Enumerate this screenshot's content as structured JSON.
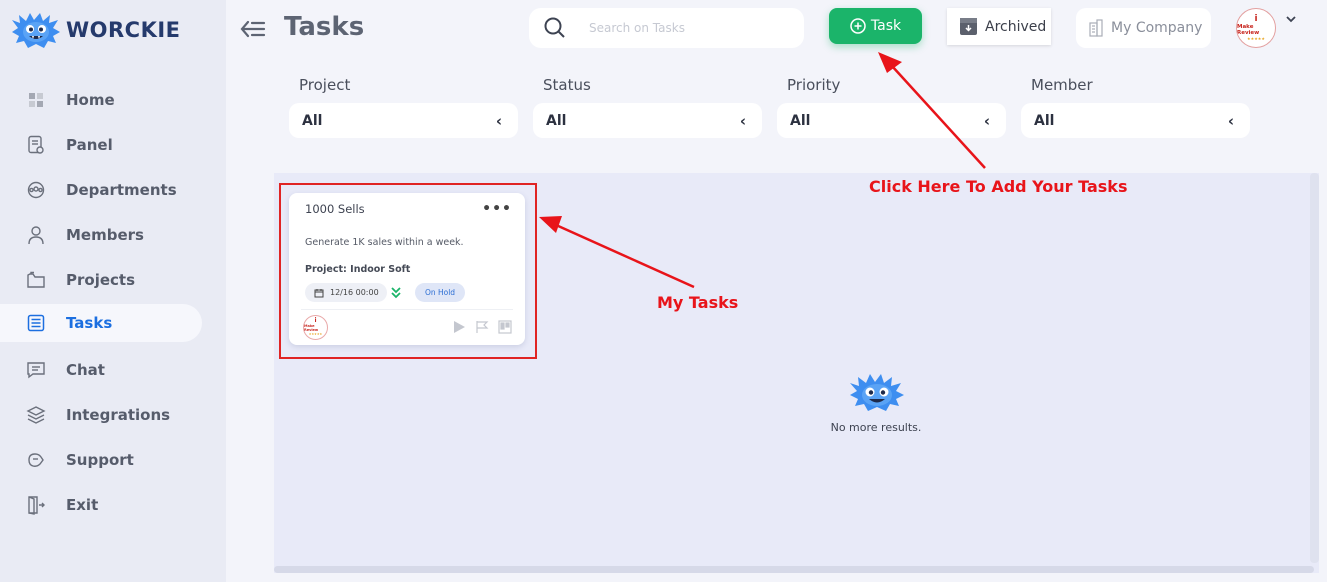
{
  "app": {
    "brand": "WORCKIE",
    "page_title": "Tasks",
    "accent_color": "#1c6fe0",
    "success_color": "#1bb46a",
    "annotation_color": "#e8141a"
  },
  "sidebar": {
    "items": [
      {
        "label": "Home",
        "icon": "grid-icon",
        "active": false
      },
      {
        "label": "Panel",
        "icon": "document-eye-icon",
        "active": false
      },
      {
        "label": "Departments",
        "icon": "team-icon",
        "active": false
      },
      {
        "label": "Members",
        "icon": "user-icon",
        "active": false
      },
      {
        "label": "Projects",
        "icon": "folder-icon",
        "active": false
      },
      {
        "label": "Tasks",
        "icon": "task-list-icon",
        "active": true
      },
      {
        "label": "Chat",
        "icon": "chat-icon",
        "active": false
      },
      {
        "label": "Integrations",
        "icon": "layers-icon",
        "active": false
      },
      {
        "label": "Support",
        "icon": "support-icon",
        "active": false
      },
      {
        "label": "Exit",
        "icon": "exit-door-icon",
        "active": false
      }
    ]
  },
  "header": {
    "search_placeholder": "Search on Tasks",
    "task_button_label": "Task",
    "archived_label": "Archived",
    "company_label": "My Company",
    "avatar_brand": "Make Review",
    "avatar_letter": "i"
  },
  "filters": [
    {
      "label": "Project",
      "value": "All"
    },
    {
      "label": "Status",
      "value": "All"
    },
    {
      "label": "Priority",
      "value": "All"
    },
    {
      "label": "Member",
      "value": "All"
    }
  ],
  "task_card": {
    "title": "1000 Sells",
    "menu": "•••",
    "description": "Generate 1K sales within a week.",
    "project": "Project: Indoor Soft",
    "date": "12/16 00:00",
    "status": "On Hold"
  },
  "empty_state": {
    "text": "No more results."
  },
  "annotations": {
    "add_tasks": "Click Here To Add Your Tasks",
    "my_tasks": "My Tasks"
  }
}
